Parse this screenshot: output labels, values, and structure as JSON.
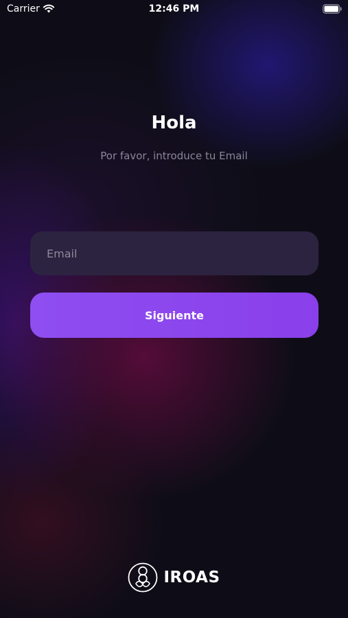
{
  "status_bar": {
    "carrier": "Carrier",
    "time": "12:46 PM"
  },
  "login": {
    "title": "Hola",
    "subtitle": "Por favor, introduce tu Email",
    "email_placeholder": "Email",
    "email_value": "",
    "next_label": "Siguiente"
  },
  "brand": {
    "name": "IROAS",
    "logo_icon": "iroas-logo-icon"
  },
  "colors": {
    "background": "#0e0d17",
    "input_bg": "#2c2340",
    "accent": "#8e4ef0",
    "subtitle": "#8a8699"
  }
}
